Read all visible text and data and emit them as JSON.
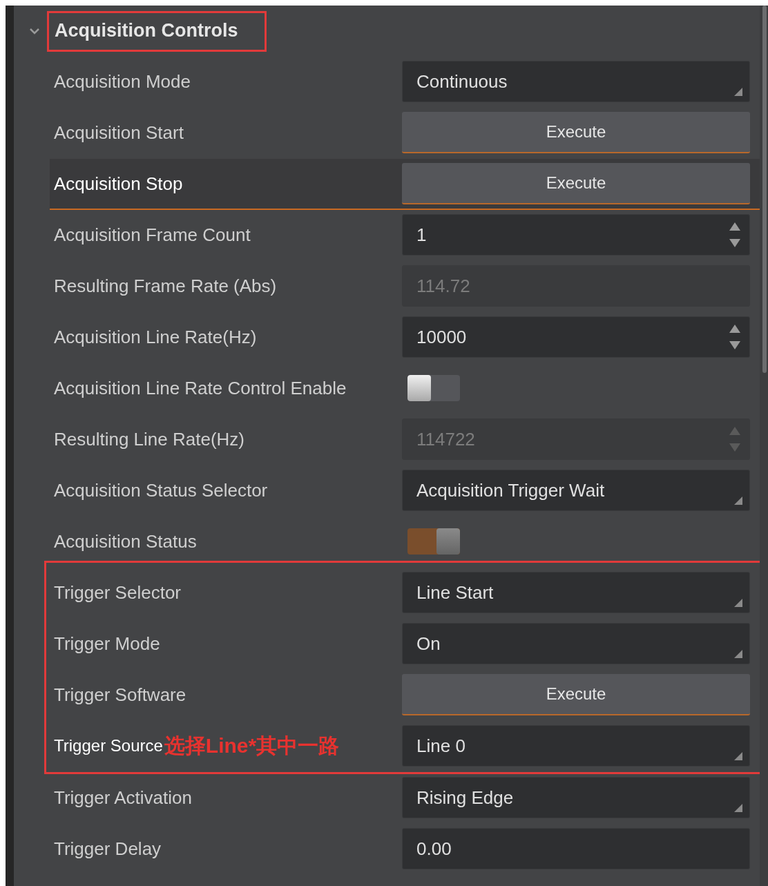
{
  "section": {
    "title": "Acquisition Controls",
    "expanded": true,
    "highlighted": true
  },
  "rows": [
    {
      "label": "Acquisition Mode",
      "kind": "dropdown",
      "value": "Continuous",
      "selected": false,
      "boxed": false
    },
    {
      "label": "Acquisition Start",
      "kind": "button",
      "value": "Execute",
      "selected": false,
      "boxed": false
    },
    {
      "label": "Acquisition Stop",
      "kind": "button",
      "value": "Execute",
      "selected": true,
      "boxed": false
    },
    {
      "label": "Acquisition Frame Count",
      "kind": "number",
      "value": "1",
      "disabled": false,
      "selected": false,
      "boxed": false
    },
    {
      "label": "Resulting Frame Rate (Abs)",
      "kind": "readonly",
      "value": "114.72",
      "selected": false,
      "boxed": false
    },
    {
      "label": "Acquisition Line Rate(Hz)",
      "kind": "number",
      "value": "10000",
      "disabled": false,
      "selected": false,
      "boxed": false
    },
    {
      "label": "Acquisition Line Rate Control Enable",
      "kind": "toggle",
      "on": false,
      "selected": false,
      "boxed": false
    },
    {
      "label": "Resulting Line Rate(Hz)",
      "kind": "number",
      "value": "114722",
      "disabled": true,
      "selected": false,
      "boxed": false
    },
    {
      "label": "Acquisition Status Selector",
      "kind": "dropdown",
      "value": "Acquisition Trigger Wait",
      "selected": false,
      "boxed": false
    },
    {
      "label": "Acquisition Status",
      "kind": "toggle",
      "on": true,
      "selected": false,
      "boxed": false
    },
    {
      "label": "Trigger Selector",
      "kind": "dropdown",
      "value": "Line Start",
      "selected": false,
      "boxed": true
    },
    {
      "label": "Trigger Mode",
      "kind": "dropdown",
      "value": "On",
      "selected": false,
      "boxed": true
    },
    {
      "label": "Trigger Software",
      "kind": "button",
      "value": "Execute",
      "selected": false,
      "boxed": true
    },
    {
      "label": "Trigger Source",
      "kind": "dropdown",
      "value": "Line 0",
      "note": "选择Line*其中一路",
      "selected": false,
      "boxed": true
    },
    {
      "label": "Trigger Activation",
      "kind": "dropdown",
      "value": "Rising Edge",
      "selected": false,
      "boxed": false
    },
    {
      "label": "Trigger Delay",
      "kind": "text",
      "value": "0.00",
      "selected": false,
      "boxed": false
    }
  ]
}
